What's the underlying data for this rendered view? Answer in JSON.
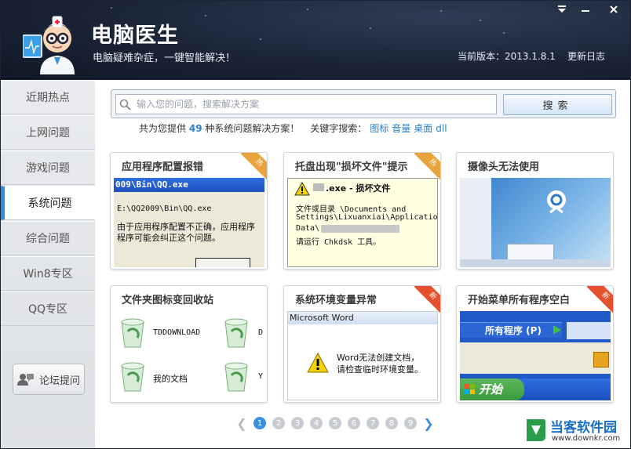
{
  "header": {
    "title": "电脑医生",
    "subtitle": "电脑疑难杂症，一键智能解决！",
    "version": "当前版本：2013.1.8.1",
    "changelog": "更新日志",
    "window_buttons": [
      "menu-icon",
      "minimize-icon",
      "close-icon"
    ]
  },
  "sidebar": {
    "items": [
      {
        "label": "近期热点"
      },
      {
        "label": "上网问题"
      },
      {
        "label": "游戏问题"
      },
      {
        "label": "系统问题",
        "active": true
      },
      {
        "label": "综合问题"
      },
      {
        "label": "Win8专区"
      },
      {
        "label": "QQ专区"
      }
    ],
    "forum_button": "论坛提问"
  },
  "search": {
    "placeholder": "输入您的问题，搜索解决方案",
    "value": "",
    "button": "搜索"
  },
  "summary": {
    "prefix": "共为您提供",
    "count": "49",
    "suffix": "种系统问题解决方案！",
    "keywords_label": "关键字搜索：",
    "keywords": [
      "图标",
      "音量",
      "桌面",
      "dll"
    ]
  },
  "cards": [
    {
      "title": "应用程序配置报错",
      "badge": "热",
      "badge_type": "hot",
      "img_lines": [
        "009\\Bin\\QQ.exe",
        "E:\\QQ2009\\Bin\\QQ.exe",
        "由于应用程序配置不正确，应用程序",
        "程序可能会纠正这个问题。"
      ]
    },
    {
      "title": "托盘出现\"损坏文件\"提示",
      "badge": "热",
      "badge_type": "hot",
      "img_lines": [
        ".exe - 损坏文件",
        "文件或目录 \\Documents and",
        "Settings\\Lixuanxiai\\Application",
        "Data\\",
        "请运行 Chkdsk 工具。"
      ]
    },
    {
      "title": "摄像头无法使用",
      "badge": "",
      "badge_type": "none",
      "img_lines": []
    },
    {
      "title": "文件夹图标变回收站",
      "badge": "",
      "badge_type": "none",
      "img_lines": [
        "TDDOWNLOAD",
        "我的文档",
        "D",
        "Y"
      ]
    },
    {
      "title": "系统环境变量异常",
      "badge": "新",
      "badge_type": "new",
      "img_lines": [
        "Microsoft Word",
        "Word无法创建文档，",
        "请检查临时环境变量。"
      ]
    },
    {
      "title": "开始菜单所有程序空白",
      "badge": "新",
      "badge_type": "new",
      "img_lines": [
        "所有程序 (P)",
        "开始"
      ]
    }
  ],
  "pager": {
    "pages": [
      "1",
      "2",
      "3",
      "4",
      "5",
      "6",
      "7",
      "8",
      "9"
    ],
    "current": "1"
  },
  "watermark": {
    "name": "当客软件园",
    "url": "www.downkr.com"
  },
  "colors": {
    "accent": "#2e8fe0",
    "header_bg": "#1a2436",
    "hot": "#e9a33a",
    "new": "#e5512e"
  }
}
